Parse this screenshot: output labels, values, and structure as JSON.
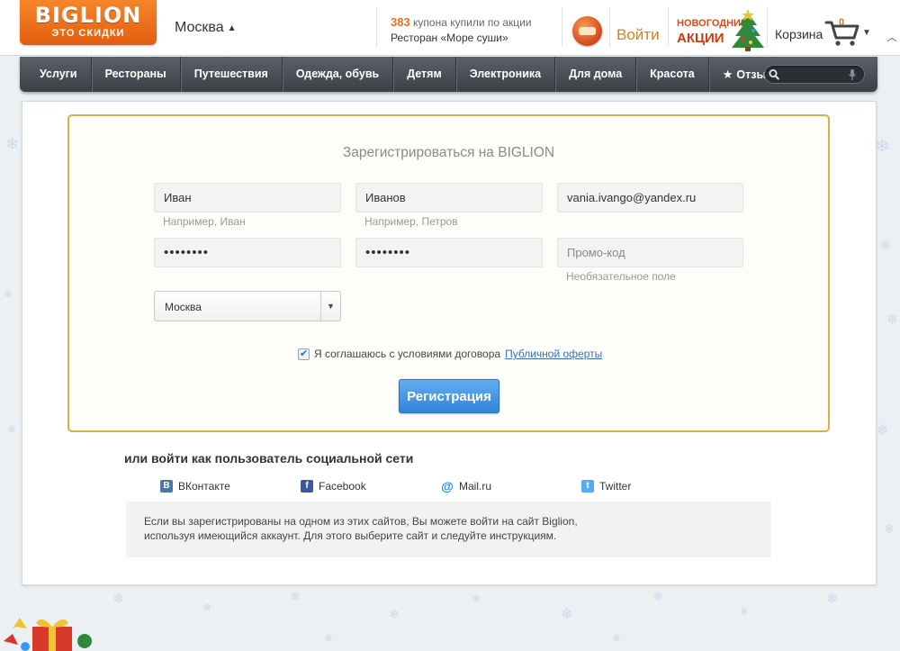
{
  "header": {
    "logo_text": "BIGLION",
    "logo_subtext": "ЭТО СКИДКИ",
    "city": "Москва",
    "coupons_count": "383",
    "coupons_text": "купона купили по акции",
    "coupons_deal": "Ресторан «Море суши»",
    "login_label": "Войти",
    "promo_line1": "НОВОГОДНИЕ",
    "promo_line2": "АКЦИИ",
    "cart_label": "Корзина",
    "cart_count": "0"
  },
  "nav": {
    "items": [
      "Услуги",
      "Рестораны",
      "Путешествия",
      "Одежда, обувь",
      "Детям",
      "Электроника",
      "Для дома",
      "Красота"
    ],
    "reviews_label": "Отзывы",
    "search_placeholder": ""
  },
  "registration": {
    "title": "Зарегистрироваться на BIGLION",
    "first_name_value": "Иван",
    "first_name_hint": "Например, Иван",
    "last_name_value": "Иванов",
    "last_name_hint": "Например, Петров",
    "email_value": "vania.ivango@yandex.ru",
    "password_value": "••••••••",
    "password_confirm_value": "••••••••",
    "promo_placeholder": "Промо-код",
    "promo_hint": "Необязательное поле",
    "city_value": "Москва",
    "agree_text": "Я соглашаюсь с условиями договора",
    "agree_link": "Публичной оферты",
    "agree_checked": true,
    "submit_label": "Регистрация"
  },
  "social": {
    "title": "или войти как пользователь социальной сети",
    "items": [
      {
        "label": "ВКонтакте",
        "icon": "vk-icon",
        "color": "#4a76a8"
      },
      {
        "label": "Facebook",
        "icon": "facebook-icon",
        "color": "#3b5998"
      },
      {
        "label": "Mail.ru",
        "icon": "mailru-icon",
        "color": "#168de2"
      },
      {
        "label": "Twitter",
        "icon": "twitter-icon",
        "color": "#55acee"
      }
    ],
    "info_line1": "Если вы зарегистрированы на одном из этих сайтов, Вы можете войти на сайт Biglion,",
    "info_line2": "используя имеющийся аккаунт. Для этого выберите сайт и следуйте инструкциям."
  },
  "colors": {
    "accent_orange": "#e5701f",
    "nav_dark": "#43484f",
    "box_border": "#d9ad52",
    "button_blue": "#3183d8",
    "link_blue": "#3670b8"
  }
}
